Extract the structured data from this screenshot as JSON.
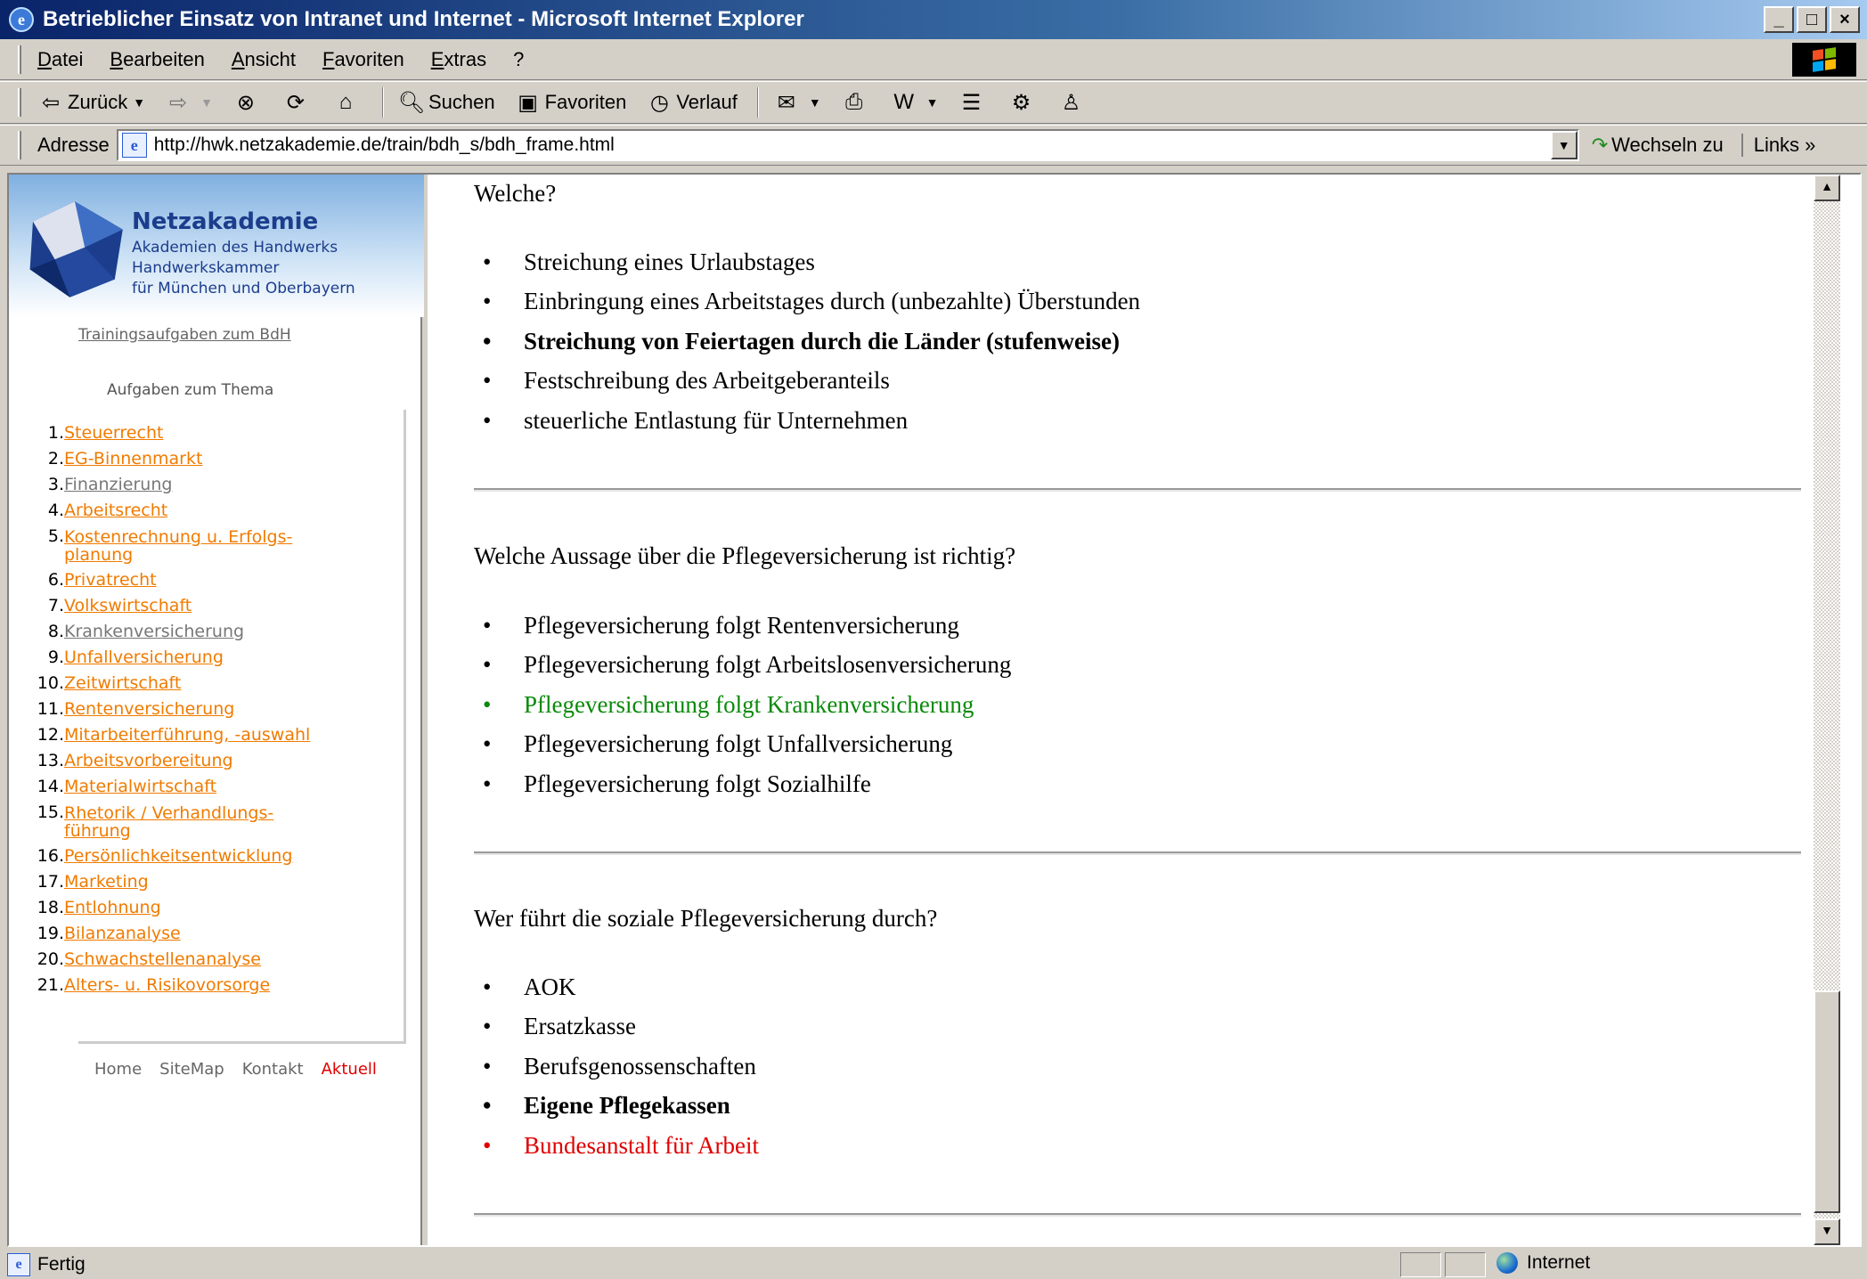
{
  "window": {
    "title": "Betrieblicher Einsatz von Intranet und Internet - Microsoft Internet Explorer",
    "buttons": [
      "_",
      "□",
      "×"
    ]
  },
  "menu": [
    "Datei",
    "Bearbeiten",
    "Ansicht",
    "Favoriten",
    "Extras",
    "?"
  ],
  "toolbar": {
    "back": "Zurück",
    "search": "Suchen",
    "favorites": "Favoriten",
    "history": "Verlauf"
  },
  "address": {
    "label": "Adresse",
    "url": "http://hwk.netzakademie.de/train/bdh_s/bdh_frame.html",
    "go": "Wechseln zu",
    "links": "Links"
  },
  "sidebar": {
    "logo_name": "Netzakademie",
    "logo_lines": [
      "Akademien des Handwerks",
      "Handwerkskammer",
      "für München und Oberbayern"
    ],
    "training_link": "Trainingsaufgaben zum BdH",
    "topics_heading": "Aufgaben zum Thema",
    "topics": [
      {
        "num": "1.",
        "label": "Steuerrecht",
        "visited": false
      },
      {
        "num": "2.",
        "label": "EG-Binnenmarkt",
        "visited": false
      },
      {
        "num": "3.",
        "label": "Finanzierung",
        "visited": true
      },
      {
        "num": "4.",
        "label": "Arbeitsrecht",
        "visited": false
      },
      {
        "num": "5.",
        "label": "Kostenrechnung u. Erfolgs-",
        "label2": "planung",
        "visited": false
      },
      {
        "num": "6.",
        "label": "Privatrecht",
        "visited": false
      },
      {
        "num": "7.",
        "label": "Volkswirtschaft",
        "visited": false
      },
      {
        "num": "8.",
        "label": "Krankenversicherung",
        "visited": true
      },
      {
        "num": "9.",
        "label": "Unfallversicherung",
        "visited": false
      },
      {
        "num": "10.",
        "label": "Zeitwirtschaft",
        "visited": false
      },
      {
        "num": "11.",
        "label": "Rentenversicherung",
        "visited": false
      },
      {
        "num": "12.",
        "label": "Mitarbeiterführung, -auswahl",
        "visited": false
      },
      {
        "num": "13.",
        "label": "Arbeitsvorbereitung",
        "visited": false
      },
      {
        "num": "14.",
        "label": "Materialwirtschaft",
        "visited": false
      },
      {
        "num": "15.",
        "label": "Rhetorik / Verhandlungs-",
        "label2": "führung",
        "visited": false
      },
      {
        "num": "16.",
        "label": "Persönlichkeitsentwicklung",
        "visited": false
      },
      {
        "num": "17.",
        "label": "Marketing",
        "visited": false
      },
      {
        "num": "18.",
        "label": "Entlohnung",
        "visited": false
      },
      {
        "num": "19.",
        "label": "Bilanzanalyse",
        "visited": false
      },
      {
        "num": "20.",
        "label": "Schwachstellenanalyse",
        "visited": false
      },
      {
        "num": "21.",
        "label": "Alters- u. Risikovorsorge",
        "visited": false
      }
    ],
    "footer": {
      "home": "Home",
      "sitemap": "SiteMap",
      "kontakt": "Kontakt",
      "aktuell": "Aktuell"
    }
  },
  "content": {
    "q1": {
      "question": "Welche?",
      "answers": [
        {
          "text": "Streichung eines Urlaubstages",
          "style": ""
        },
        {
          "text": "Einbringung eines Arbeitstages durch (unbezahlte) Überstunden",
          "style": ""
        },
        {
          "text": "Streichung von Feiertagen durch die Länder (stufenweise)",
          "style": "correct"
        },
        {
          "text": "Festschreibung des Arbeitgeberanteils",
          "style": ""
        },
        {
          "text": "steuerliche Entlastung für Unternehmen",
          "style": ""
        }
      ]
    },
    "q2": {
      "question": "Welche Aussage über die Pflegeversicherung ist richtig?",
      "answers": [
        {
          "text": "Pflegeversicherung folgt Rentenversicherung",
          "style": ""
        },
        {
          "text": "Pflegeversicherung folgt Arbeitslosenversicherung",
          "style": ""
        },
        {
          "text": "Pflegeversicherung folgt Krankenversicherung",
          "style": "green"
        },
        {
          "text": "Pflegeversicherung folgt Unfallversicherung",
          "style": ""
        },
        {
          "text": "Pflegeversicherung folgt Sozialhilfe",
          "style": ""
        }
      ]
    },
    "q3": {
      "question": "Wer führt die soziale Pflegeversicherung durch?",
      "answers": [
        {
          "text": "AOK",
          "style": ""
        },
        {
          "text": "Ersatzkasse",
          "style": ""
        },
        {
          "text": "Berufsgenossenschaften",
          "style": ""
        },
        {
          "text": "Eigene Pflegekassen",
          "style": "correct"
        },
        {
          "text": "Bundesanstalt für Arbeit",
          "style": "red"
        }
      ]
    }
  },
  "status": {
    "text": "Fertig",
    "zone": "Internet"
  }
}
